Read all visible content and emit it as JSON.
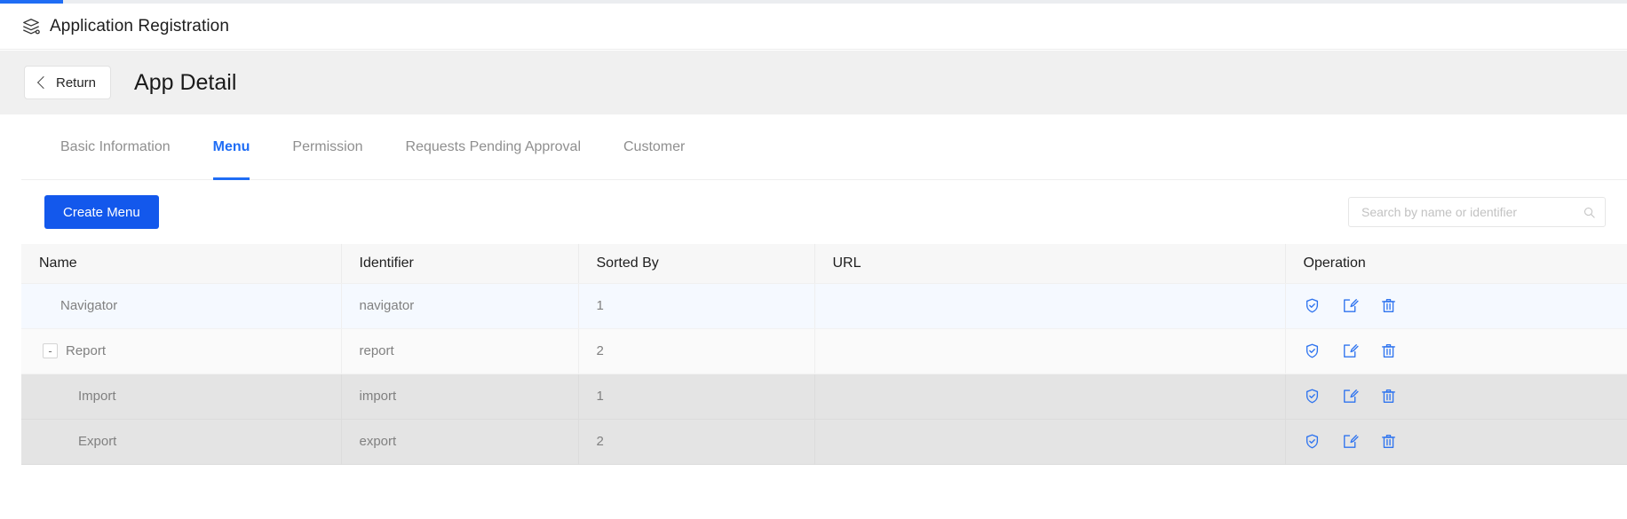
{
  "accent_color": "#1f6df5",
  "topbar": {
    "icon": "layers-stack-icon",
    "title": "Application Registration"
  },
  "subheader": {
    "return_label": "Return",
    "return_icon": "chevron-left-icon",
    "page_title": "App Detail"
  },
  "tabs": [
    {
      "label": "Basic Information",
      "active": false
    },
    {
      "label": "Menu",
      "active": true
    },
    {
      "label": "Permission",
      "active": false
    },
    {
      "label": "Requests Pending Approval",
      "active": false
    },
    {
      "label": "Customer",
      "active": false
    }
  ],
  "toolbar": {
    "create_label": "Create Menu",
    "search_value": "",
    "search_placeholder": "Search by name or identifier",
    "search_icon": "search-icon"
  },
  "table": {
    "columns": [
      "Name",
      "Identifier",
      "Sorted By",
      "URL",
      "Operation"
    ],
    "rows": [
      {
        "name": "Navigator",
        "identifier": "navigator",
        "sorted_by": "1",
        "url": "",
        "level": 0,
        "toggle": "",
        "zebra": "a"
      },
      {
        "name": "Report",
        "identifier": "report",
        "sorted_by": "2",
        "url": "",
        "level": 0,
        "toggle": "-",
        "zebra": "b"
      },
      {
        "name": "Import",
        "identifier": "import",
        "sorted_by": "1",
        "url": "",
        "level": 1,
        "toggle": "",
        "zebra": "c"
      },
      {
        "name": "Export",
        "identifier": "export",
        "sorted_by": "2",
        "url": "",
        "level": 1,
        "toggle": "",
        "zebra": "c"
      }
    ],
    "row_operations": [
      "shield-check-icon",
      "edit-pencil-icon",
      "trash-delete-icon"
    ]
  }
}
